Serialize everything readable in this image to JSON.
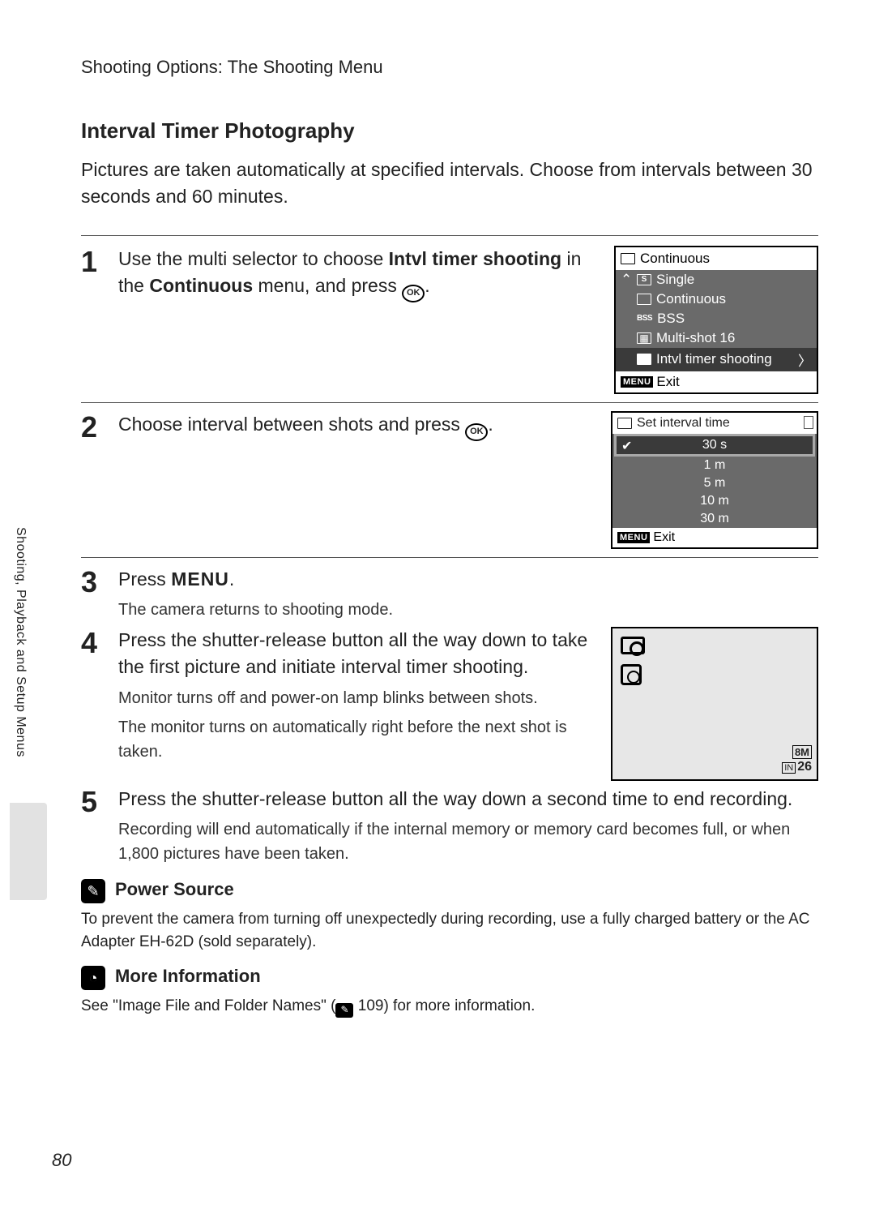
{
  "header": "Shooting Options: The Shooting Menu",
  "title": "Interval Timer Photography",
  "intro": "Pictures are taken automatically at specified intervals. Choose from intervals between 30 seconds and 60 minutes.",
  "side_label": "Shooting, Playback and Setup Menus",
  "page_number": "80",
  "ok_label": "OK",
  "menu_label": "MENU",
  "steps": {
    "s1": {
      "num": "1",
      "text_before": "Use the multi selector to choose ",
      "bold1": "Intvl timer shooting",
      "text_mid": " in the ",
      "bold2": "Continuous",
      "text_after": " menu, and press ",
      "lcd": {
        "title": "Continuous",
        "items": [
          "Single",
          "Continuous",
          "BSS",
          "Multi-shot 16",
          "Intvl timer shooting"
        ],
        "exit": "Exit"
      }
    },
    "s2": {
      "num": "2",
      "text": "Choose interval between shots and press ",
      "lcd": {
        "title": "Set interval time",
        "options": [
          "30 s",
          "1 m",
          "5 m",
          "10 m",
          "30 m"
        ],
        "exit": "Exit"
      }
    },
    "s3": {
      "num": "3",
      "lead_before": "Press ",
      "lead_after": ".",
      "sub": "The camera returns to shooting mode."
    },
    "s4": {
      "num": "4",
      "lead": "Press the shutter-release button all the way down to take the first picture and initiate interval timer shooting.",
      "sub1": "Monitor turns off and power-on lamp blinks between shots.",
      "sub2": "The monitor turns on automatically right before the next shot is taken.",
      "preview": {
        "mode": "8M",
        "in": "IN",
        "count": "26"
      }
    },
    "s5": {
      "num": "5",
      "lead": "Press the shutter-release button all the way down a second time to end recording.",
      "sub": "Recording will end automatically if the internal memory or memory card becomes full, or when 1,800 pictures have been taken."
    }
  },
  "notes": {
    "power": {
      "title": "Power Source",
      "body": "To prevent the camera from turning off unexpectedly during recording, use a fully charged battery or the AC Adapter EH-62D (sold separately)."
    },
    "more": {
      "title": "More Information",
      "body_before": "See \"Image File and Folder Names\" (",
      "body_ref": "109",
      "body_after": ") for more information."
    }
  }
}
